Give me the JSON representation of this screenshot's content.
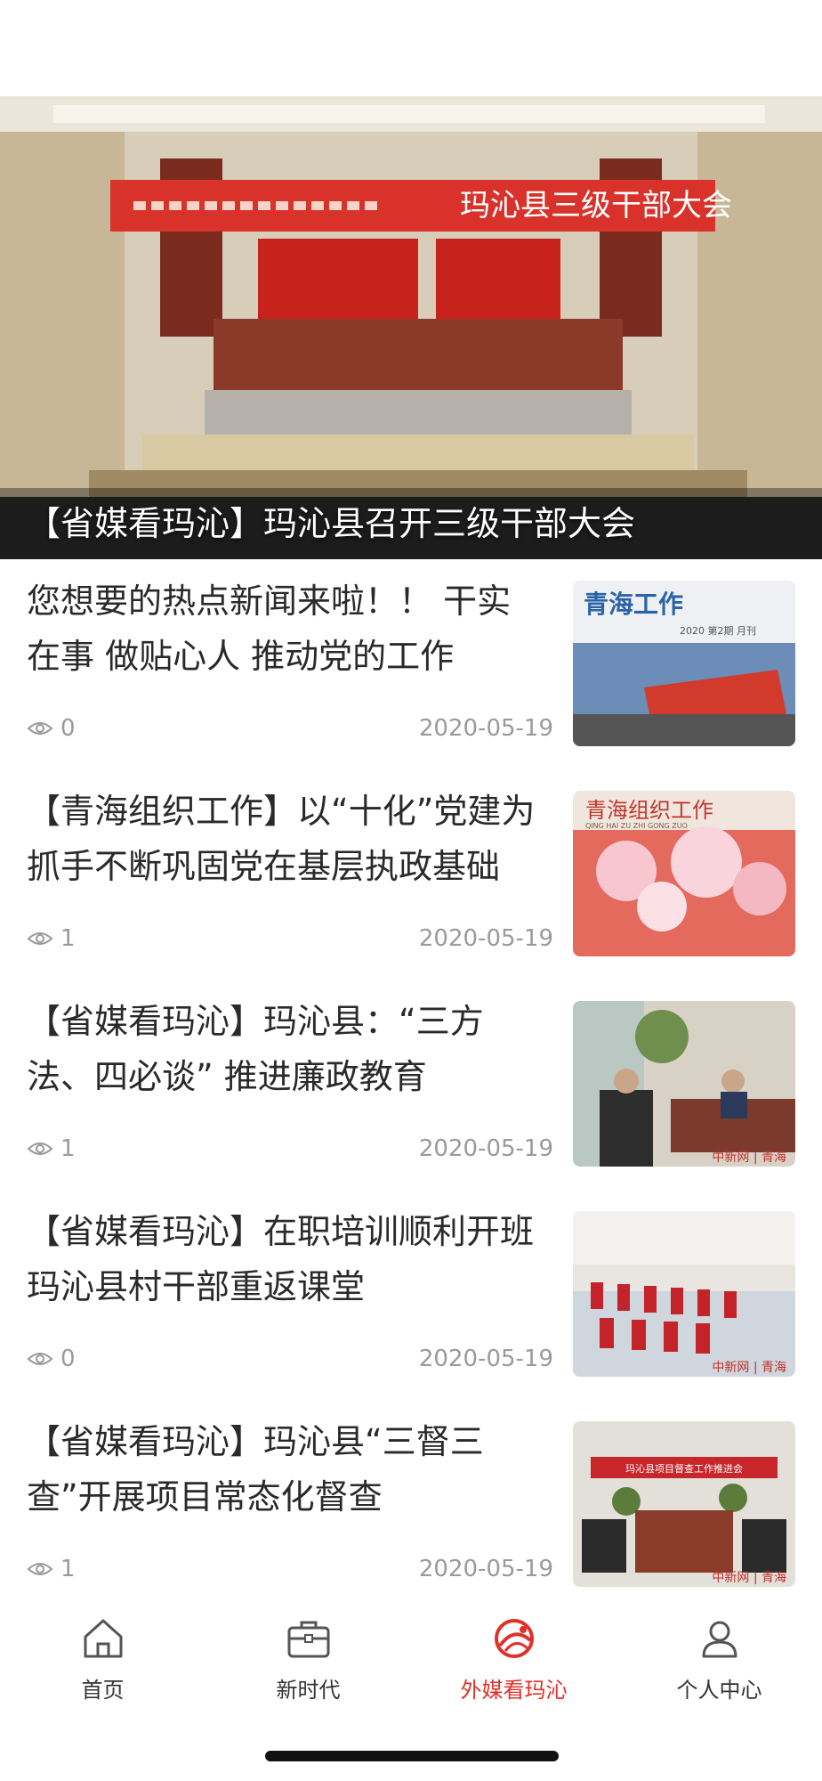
{
  "banner": {
    "caption": "【省媒看玛沁】玛沁县召开三级干部大会",
    "image_sign_text": "玛沁县三级干部大会",
    "dots_count": 3,
    "active_dot": 1
  },
  "news": [
    {
      "title": "您想要的热点新闻来啦！！ 干实在事 做贴心人 推动党的工作",
      "views": "0",
      "date": "2020-05-19",
      "thumb_text": "青海工作",
      "thumb_sub": "2020 第2期 月刊"
    },
    {
      "title": "【青海组织工作】以“十化”党建为抓手不断巩固党在基层执政基础",
      "views": "1",
      "date": "2020-05-19",
      "thumb_text": "青海组织工作",
      "thumb_sub": "QING HAI ZU ZHI GONG ZUO"
    },
    {
      "title": "【省媒看玛沁】玛沁县：“三方法、四必谈” 推进廉政教育",
      "views": "1",
      "date": "2020-05-19",
      "thumb_text": "中新网 | 青海",
      "thumb_sub": ""
    },
    {
      "title": "【省媒看玛沁】在职培训顺利开班 玛沁县村干部重返课堂",
      "views": "0",
      "date": "2020-05-19",
      "thumb_text": "中新网 | 青海",
      "thumb_sub": ""
    },
    {
      "title": "【省媒看玛沁】玛沁县“三督三查”开展项目常态化督查",
      "views": "1",
      "date": "2020-05-19",
      "thumb_text": "中新网 | 青海",
      "thumb_sub": "玛沁县项目督查工作推进会"
    }
  ],
  "tabs": [
    {
      "label": "首页",
      "icon": "home-icon",
      "active": false
    },
    {
      "label": "新时代",
      "icon": "briefcase-icon",
      "active": false
    },
    {
      "label": "外媒看玛沁",
      "icon": "news-logo-icon",
      "active": true
    },
    {
      "label": "个人中心",
      "icon": "person-icon",
      "active": false
    }
  ],
  "colors": {
    "accent": "#e0302a",
    "text": "#2a2a2a",
    "meta": "#9a9a9a"
  }
}
